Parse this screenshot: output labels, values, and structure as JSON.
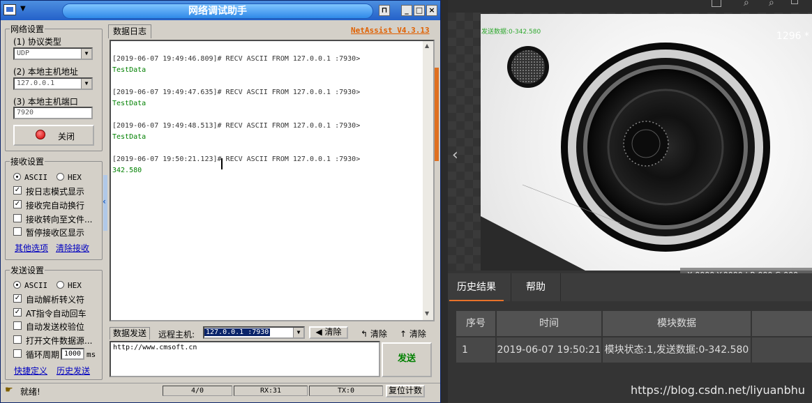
{
  "netassist": {
    "title": "网络调试助手",
    "brand": "NetAssist V4.3.13",
    "network": {
      "legend": "网络设置",
      "protocol_label": "(1) 协议类型",
      "protocol_value": "UDP",
      "host_label": "(2) 本地主机地址",
      "host_value": "127.0.0.1",
      "port_label": "(3) 本地主机端口",
      "port_value": "7920",
      "close_label": "关闭"
    },
    "receive": {
      "legend": "接收设置",
      "ascii": "ASCII",
      "hex": "HEX",
      "options": [
        {
          "label": "按日志模式显示",
          "checked": "✓"
        },
        {
          "label": "接收完自动换行",
          "checked": "✓"
        },
        {
          "label": "接收转向至文件...",
          "checked": ""
        },
        {
          "label": "暂停接收区显示",
          "checked": ""
        }
      ],
      "link_more": "其他选项",
      "link_clear": "清除接收"
    },
    "send": {
      "legend": "发送设置",
      "ascii": "ASCII",
      "hex": "HEX",
      "options": [
        {
          "label": "自动解析转义符",
          "checked": "✓"
        },
        {
          "label": "AT指令自动回车",
          "checked": "✓"
        },
        {
          "label": "自动发送校验位",
          "checked": ""
        },
        {
          "label": "打开文件数据源...",
          "checked": ""
        }
      ],
      "cycle_label": "循环周期",
      "cycle_value": "1000",
      "cycle_unit": "ms",
      "link_shortcut": "快捷定义",
      "link_history": "历史发送"
    },
    "log_tab": "数据日志",
    "log": [
      {
        "head": "[2019-06-07 19:49:46.809]# RECV ASCII FROM 127.0.0.1 :7930>",
        "data": "TestData"
      },
      {
        "head": "[2019-06-07 19:49:47.635]# RECV ASCII FROM 127.0.0.1 :7930>",
        "data": "TestData"
      },
      {
        "head": "[2019-06-07 19:49:48.513]# RECV ASCII FROM 127.0.0.1 :7930>",
        "data": "TestData"
      },
      {
        "head": "[2019-06-07 19:50:21.123]# RECV ASCII FROM 127.0.0.1 :7930>",
        "data": "342.580"
      }
    ],
    "send_tab": "数据发送",
    "remote_label": "远程主机:",
    "remote_value": "127.0.0.1 :7930",
    "clear1": "清除",
    "clear2": "清除",
    "clear3": "清除",
    "send_text": "http://www.cmsoft.cn",
    "send_button": "发送",
    "status": {
      "ready": "就绪!",
      "count": "4/0",
      "rx": "RX:31",
      "tx": "TX:0",
      "reset": "复位计数"
    }
  },
  "viewer": {
    "overlay_text": "发送数据:0-342.580",
    "image_count": "1296 *",
    "coords": "X:0000  Y:0000  |  R:000  G:000",
    "tabs": [
      "历史结果",
      "帮助"
    ],
    "table": {
      "headers": [
        "序号",
        "时间",
        "模块数据"
      ],
      "row": [
        "1",
        "2019-06-07 19:50:21",
        "模块状态:1,发送数据:0-342.580"
      ]
    },
    "watermark": "https://blog.csdn.net/liyuanbhu"
  },
  "colors": {
    "title_blue": "#2f89e8",
    "brand_orange": "#e06000",
    "log_green": "#008000",
    "tab_accent": "#e8722a"
  }
}
